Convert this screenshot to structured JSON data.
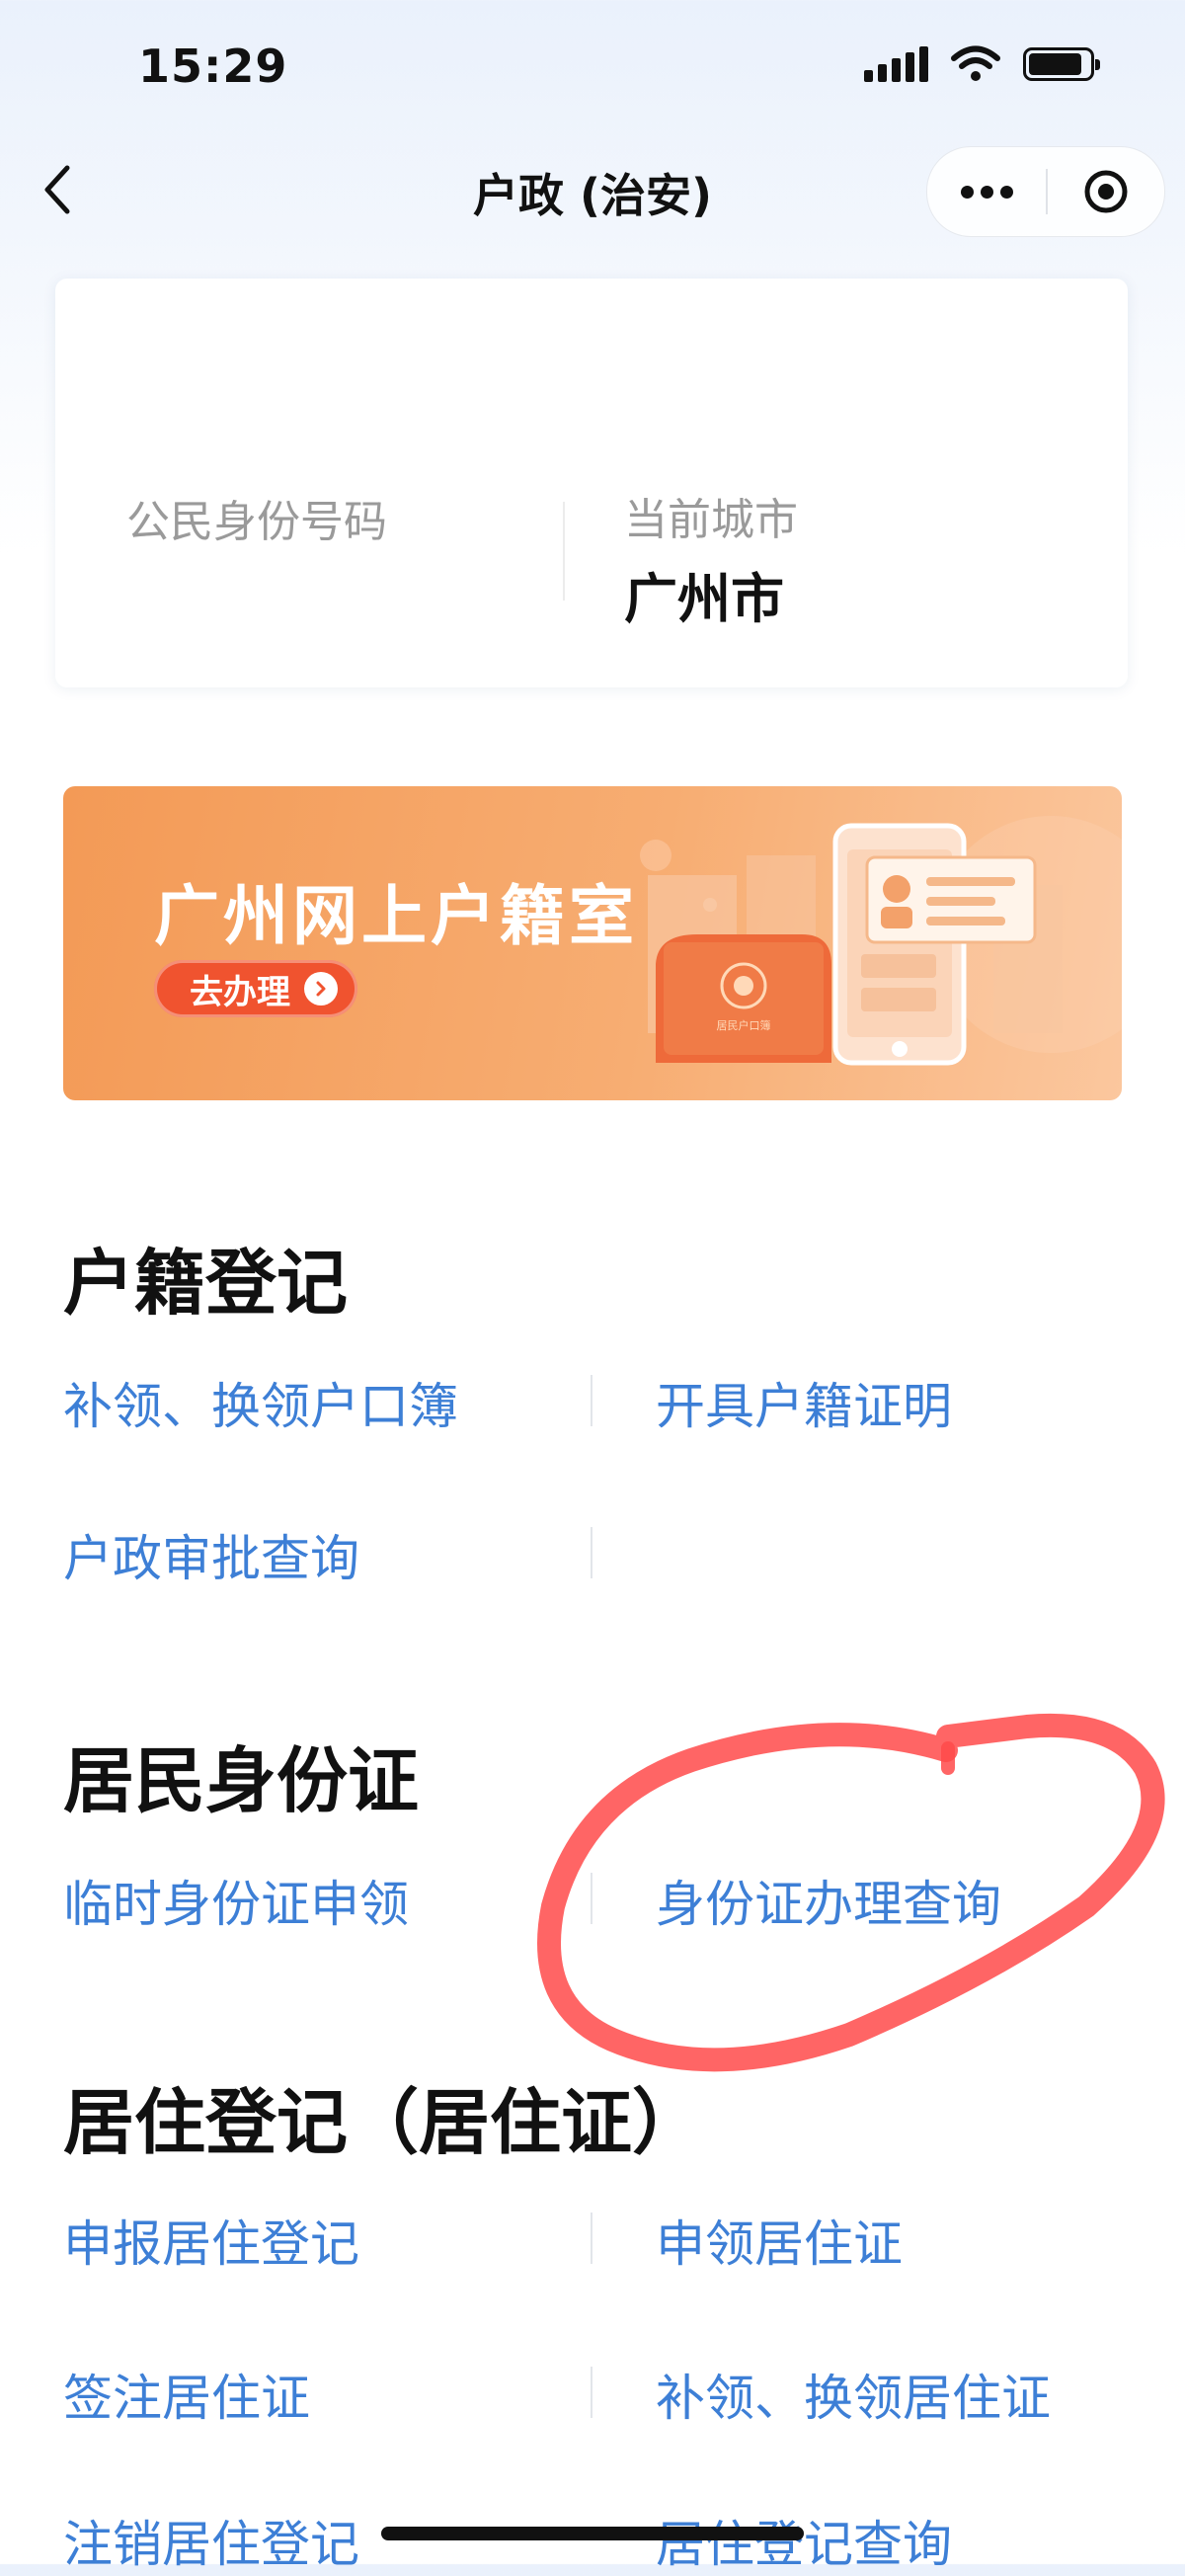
{
  "status_bar": {
    "time": "15:29"
  },
  "nav": {
    "title": "户政 (治安)"
  },
  "info_card": {
    "id_label": "公民身份号码",
    "city_label": "当前城市",
    "city_value": "广州市"
  },
  "banner": {
    "title": "广州网上户籍室",
    "button_label": "去办理",
    "booklet_text": "居民户口簿"
  },
  "sections": {
    "household": {
      "title": "户籍登记",
      "links": [
        "补领、换领户口簿",
        "开具户籍证明",
        "户政审批查询"
      ]
    },
    "id_card": {
      "title": "居民身份证",
      "links": [
        "临时身份证申领",
        "身份证办理查询"
      ]
    },
    "residence": {
      "title": "居住登记（居住证）",
      "links": [
        "申报居住登记",
        "申领居住证",
        "签注居住证",
        "补领、换领居住证",
        "注销居住登记",
        "居住登记查询"
      ]
    }
  },
  "colors": {
    "link": "#3d7fd6",
    "banner_orange": "#f39a56",
    "button_red": "#f0532f",
    "annotation_red": "#ff4a4a"
  }
}
